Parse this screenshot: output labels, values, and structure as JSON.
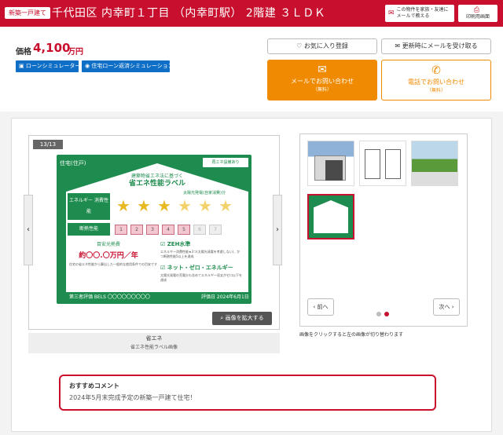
{
  "header": {
    "badge": "新築一戸建て",
    "title": "千代田区 内幸町１丁目 （内幸町駅） 2階建 ３ＬＤＫ",
    "share_label": "この物件を家族・友達に メールで教える",
    "print_label": "印刷用画面"
  },
  "price": {
    "label": "価格",
    "value": "4,100",
    "unit": "万円"
  },
  "loan": {
    "sim1": "ローンシミュレーター",
    "sim2": "住宅ローン返済シミュレーション"
  },
  "actions": {
    "favorite": "お気に入り登録",
    "notify": "更新時にメールを受け取る",
    "mail_label": "メールでお問い合わせ",
    "mail_sub": "（無料）",
    "tel_label": "電話でお問い合わせ",
    "tel_sub": "（無料）"
  },
  "gallery": {
    "counter": "13/13",
    "zoom_label": "画像を拡大する",
    "caption_title": "省エネ",
    "caption_sub": "省エネ性能ラベル画像",
    "prev_label": "前へ",
    "next_label": "次へ",
    "thumb_note": "画像をクリックすると左の画像が切り替わります",
    "current_index": 2,
    "page_count": 2
  },
  "energy_label": {
    "tag": "住宅(住戸)",
    "corner": "再エネ設備あり",
    "subtitle": "建築物省エネ法に基づく",
    "heading": "省エネ性能ラベル",
    "row1": "エネルギー 消費性能",
    "row2": "断熱性能",
    "solar_note": "太陽光発電(自家消費)分",
    "star_count": 6,
    "full_stars": 3,
    "insulation_blocks": [
      "1",
      "2",
      "3",
      "4",
      "5",
      "6",
      "7"
    ],
    "insulation_level": 5,
    "cost_label": "目安光熱費",
    "cost_value": "約〇〇.〇万円／年",
    "cost_note": "住宅の省エネ性能から算出した一般的な使用条件での目安です",
    "zeh": "ZEH水準",
    "zeh_note": "エネルギー消費性能★3つ(太陽光発電を考慮しない)、かつ断熱性能5以上を達成",
    "nz": "ネット・ゼロ・エネルギー",
    "nz_note": "太陽光発電の売電分も含めてエネルギー収支がゼロ以下を達成",
    "bels": "第三者評価 BELS 〇〇〇〇〇〇〇〇〇",
    "date": "評価日 2024年6月1日"
  },
  "comment": {
    "title": "おすすめコメント",
    "text": "2024年5月末完成予定の新築一戸建て住宅！"
  },
  "colors": {
    "brand_red": "#c8102e",
    "orange": "#f08a00",
    "green": "#1e8c4e",
    "blue": "#0f6fc6"
  }
}
